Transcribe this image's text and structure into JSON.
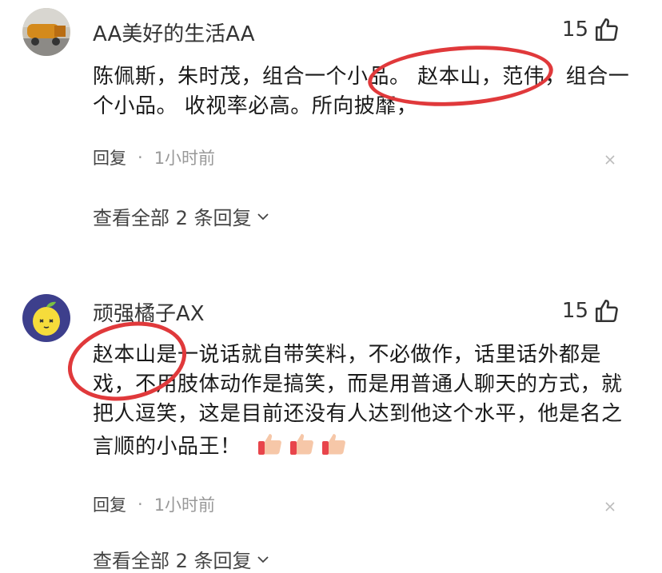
{
  "comments": [
    {
      "username": "AA美好的生活AA",
      "likes": "15",
      "text": "陈佩斯，朱时茂，组合一个小品。 赵本山，范伟，组合一个小品。 收视率必高。所向披靡，",
      "reply_label": "回复",
      "separator": "·",
      "time": "1小时前",
      "view_replies": "查看全部 2 条回复"
    },
    {
      "username": "顽强橘子AX",
      "likes": "15",
      "text": "赵本山是一说话就自带笑料，不必做作，话里话外都是戏，不用肢体动作是搞笑，而是用普通人聊天的方式，就把人逗笑，这是目前还没有人达到他这个水平，他是名之言顺的小品王！",
      "emojis": [
        "thumbs-up",
        "thumbs-up",
        "thumbs-up"
      ],
      "reply_label": "回复",
      "separator": "·",
      "time": "1小时前",
      "view_replies": "查看全部 2 条回复"
    }
  ],
  "annotation_color": "#e0393b"
}
